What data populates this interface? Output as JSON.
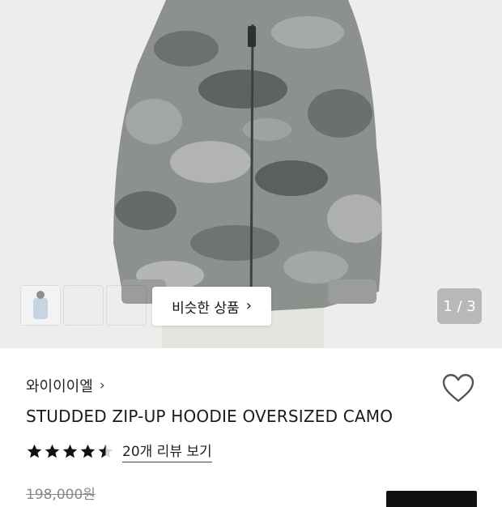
{
  "gallery": {
    "counter": "1 / 3",
    "similar_products_label": "비슷한 상품",
    "thumbnails": [
      "thumbnail-grey-hoodie",
      "thumbnail-dark-camo-hoodie",
      "thumbnail-light-blue-hoodie"
    ]
  },
  "product": {
    "brand": "와이이이엘",
    "title": "STUDDED ZIP-UP HOODIE OVERSIZED CAMO",
    "rating_value": 4.5,
    "review_link_label": "20개 리뷰 보기",
    "original_price": "198,000원"
  },
  "icons": {
    "brand_chevron": "chevron-right-icon",
    "wishlist": "heart-outline-icon",
    "star": "star-icon"
  },
  "colors": {
    "star_fill": "#111111",
    "button_dark": "#111111"
  }
}
